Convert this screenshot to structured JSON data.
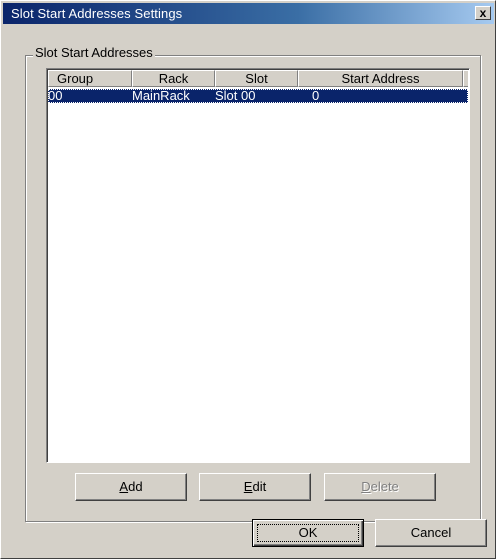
{
  "window": {
    "title": "Slot Start Addresses Settings",
    "close_glyph": "x"
  },
  "group": {
    "label": "Slot Start Addresses"
  },
  "table": {
    "columns": [
      "Group",
      "Rack",
      "Slot",
      "Start Address"
    ],
    "rows": [
      {
        "group": "00",
        "rack": "MainRack",
        "slot": "Slot 00",
        "start_address": "0"
      }
    ],
    "selected_row": 0
  },
  "buttons": {
    "add": {
      "mnemonic": "A",
      "rest": "dd"
    },
    "edit": {
      "mnemonic": "E",
      "rest": "dit"
    },
    "delete": {
      "mnemonic": "D",
      "rest": "elete",
      "disabled": true
    },
    "ok": "OK",
    "cancel": "Cancel"
  },
  "colors": {
    "titlebar_start": "#0a246a",
    "titlebar_end": "#a6caf0",
    "face": "#d4d0c8",
    "selection": "#0a246a"
  }
}
